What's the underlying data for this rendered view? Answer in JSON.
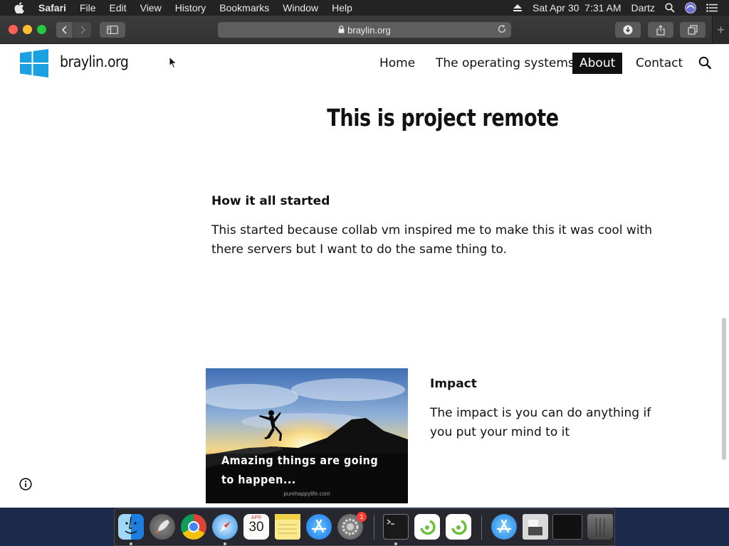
{
  "menubar": {
    "app": "Safari",
    "items": [
      "File",
      "Edit",
      "View",
      "History",
      "Bookmarks",
      "Window",
      "Help"
    ],
    "datetime": "Sat Apr 30  7:31 AM",
    "user": "Dartz"
  },
  "browser": {
    "url": "braylin.org"
  },
  "site": {
    "name": "braylin.org",
    "nav": {
      "home": "Home",
      "os": "The operating systems",
      "about": "About",
      "contact": "Contact"
    },
    "title": "This is project remote",
    "section1": {
      "heading": "How it all started",
      "body": "This started because collab vm inspired me to make this it was cool with there servers but I want to do the same thing to."
    },
    "section2": {
      "heading": "Impact",
      "body": "The impact is you can do anything if you put your mind to it",
      "image_caption_line1": "Amazing things are going",
      "image_caption_line2": "to happen...",
      "image_credit": "purehappylife.com"
    },
    "active_nav_color": "#111111"
  },
  "dock": {
    "calendar_month": "APR",
    "calendar_day": "30",
    "settings_badge": "1"
  }
}
